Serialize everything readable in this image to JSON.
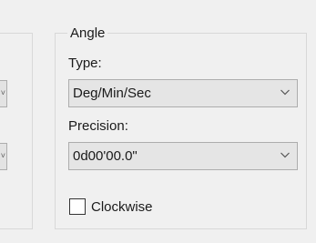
{
  "angle": {
    "title": "Angle",
    "type_label": "Type:",
    "type_value": "Deg/Min/Sec",
    "precision_label": "Precision:",
    "precision_value": "0d00'00.0\"",
    "clockwise_label": "Clockwise",
    "clockwise_checked": false
  },
  "icons": {
    "dropdown": "chevron-down-icon"
  }
}
